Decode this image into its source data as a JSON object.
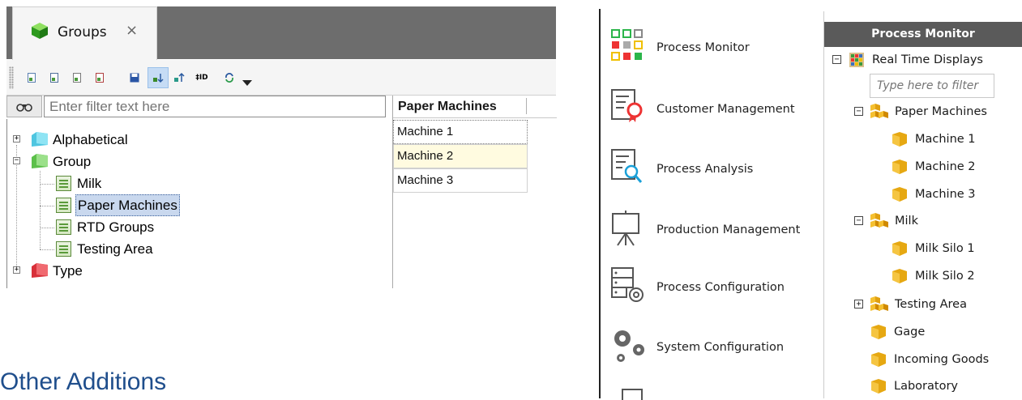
{
  "groups_window": {
    "tab": {
      "label": "Groups",
      "close": "×"
    },
    "toolbar": {
      "buttons": [
        "new-icon",
        "open-icon",
        "edit-icon",
        "delete-icon",
        "save-icon",
        "sort-group-icon",
        "sort-alpha-icon",
        "id-icon",
        "refresh-icon",
        "dropdown-icon"
      ]
    },
    "filter": {
      "placeholder": "Enter filter text here"
    },
    "tree": {
      "alphabetical": "Alphabetical",
      "group": "Group",
      "children": [
        "Milk",
        "Paper Machines",
        "RTD Groups",
        "Testing Area"
      ],
      "type": "Type"
    },
    "grid": {
      "header": "Paper Machines",
      "rows": [
        "Machine 1",
        "Machine 2",
        "Machine 3"
      ]
    }
  },
  "section_heading": "Other Additions",
  "nav": {
    "items": [
      "Process Monitor",
      "Customer Management",
      "Process Analysis",
      "Production Management",
      "Process Configuration",
      "System Configuration"
    ]
  },
  "process_monitor": {
    "header": "Process Monitor",
    "root": "Real Time Displays",
    "filter_placeholder": "Type here to filter",
    "paper_machines": {
      "label": "Paper Machines",
      "children": [
        "Machine 1",
        "Machine 2",
        "Machine 3"
      ]
    },
    "milk": {
      "label": "Milk",
      "children": [
        "Milk Silo 1",
        "Milk Silo 2"
      ]
    },
    "testing_area": "Testing Area",
    "others": [
      "Gage",
      "Incoming Goods",
      "Laboratory"
    ]
  },
  "colors": {
    "tabbar": "#6d6d6d",
    "selection": "#c9d8ee",
    "heading": "#1f4e8c",
    "pm_header": "#5a5a5a",
    "row_highlight": "#fffbe0"
  }
}
